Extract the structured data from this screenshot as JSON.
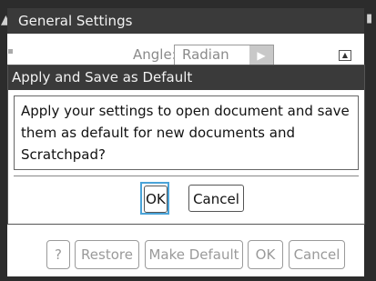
{
  "general_settings": {
    "title": "General Settings",
    "angle_label": "Angle:",
    "angle_value": "Radian",
    "buttons": {
      "help": "?",
      "restore": "Restore",
      "make_default": "Make Default",
      "ok": "OK",
      "cancel": "Cancel"
    }
  },
  "modal": {
    "title": "Apply and Save as Default",
    "message": "Apply your settings to open document and save them as default for new documents and Scratchpad?",
    "ok": "OK",
    "cancel": "Cancel"
  },
  "icons": {
    "select_arrow": "triangle-right",
    "scroll_up": "scroll-up-arrow"
  },
  "colors": {
    "titlebar": "#3a3a3a",
    "focus": "#4aa3d8",
    "disabled_text": "#9a9a9a"
  }
}
